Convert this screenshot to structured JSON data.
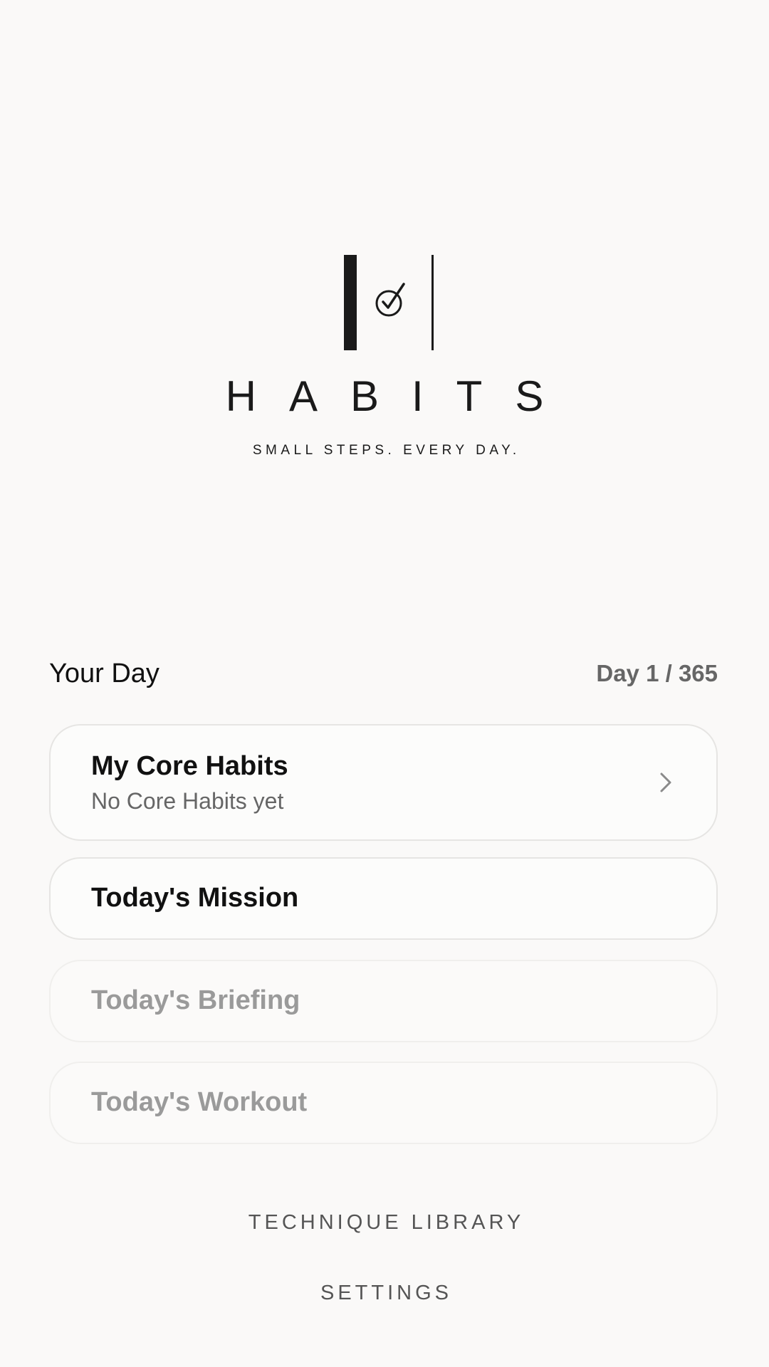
{
  "logo": {
    "wordmark": "HABITS",
    "tagline": "SMALL STEPS. EVERY DAY.",
    "icon": "check-circle-icon",
    "color": "#1a1a1a"
  },
  "day": {
    "title": "Your Day",
    "counter": "Day 1 / 365"
  },
  "cards": {
    "core_habits": {
      "title": "My Core Habits",
      "subtitle": "No Core Habits yet",
      "icon": "chevron-right-icon"
    },
    "mission": {
      "title": "Today's Mission"
    },
    "briefing": {
      "title": "Today's Briefing"
    },
    "workout": {
      "title": "Today's Workout"
    }
  },
  "footer": {
    "technique_library": "TECHNIQUE LIBRARY",
    "settings": "SETTINGS"
  },
  "colors": {
    "background": "#faf9f8",
    "text_primary": "#111111",
    "text_secondary": "#666666",
    "text_disabled": "#9a9a9a"
  }
}
